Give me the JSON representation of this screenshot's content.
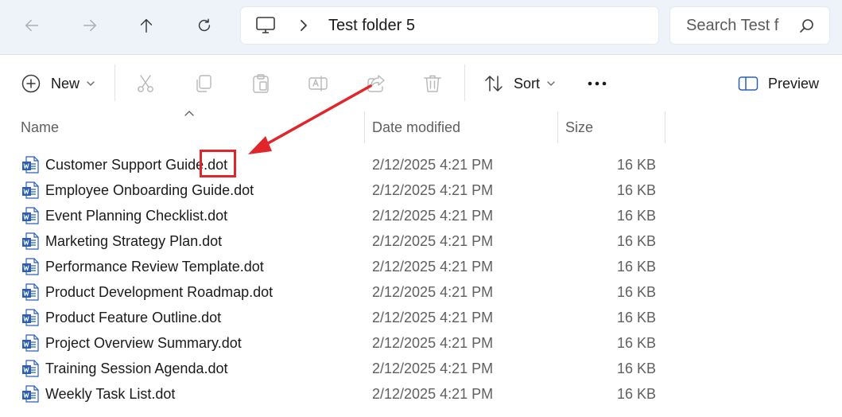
{
  "address": {
    "crumb": "Test folder 5"
  },
  "search": {
    "placeholder": "Search Test f"
  },
  "toolbar": {
    "new_label": "New",
    "sort_label": "Sort",
    "preview_label": "Preview"
  },
  "columns": {
    "name": "Name",
    "date": "Date modified",
    "size": "Size"
  },
  "files": [
    {
      "name": "Customer Support Guide.dot",
      "date": "2/12/2025 4:21 PM",
      "size": "16 KB"
    },
    {
      "name": "Employee Onboarding Guide.dot",
      "date": "2/12/2025 4:21 PM",
      "size": "16 KB"
    },
    {
      "name": "Event Planning Checklist.dot",
      "date": "2/12/2025 4:21 PM",
      "size": "16 KB"
    },
    {
      "name": "Marketing Strategy Plan.dot",
      "date": "2/12/2025 4:21 PM",
      "size": "16 KB"
    },
    {
      "name": "Performance Review Template.dot",
      "date": "2/12/2025 4:21 PM",
      "size": "16 KB"
    },
    {
      "name": "Product Development Roadmap.dot",
      "date": "2/12/2025 4:21 PM",
      "size": "16 KB"
    },
    {
      "name": "Product Feature Outline.dot",
      "date": "2/12/2025 4:21 PM",
      "size": "16 KB"
    },
    {
      "name": "Project Overview Summary.dot",
      "date": "2/12/2025 4:21 PM",
      "size": "16 KB"
    },
    {
      "name": "Training Session Agenda.dot",
      "date": "2/12/2025 4:21 PM",
      "size": "16 KB"
    },
    {
      "name": "Weekly Task List.dot",
      "date": "2/12/2025 4:21 PM",
      "size": "16 KB"
    }
  ],
  "icons": {
    "back": "arrow-left-icon",
    "forward": "arrow-right-icon",
    "up": "arrow-up-icon",
    "refresh": "refresh-icon",
    "this_pc": "monitor-icon",
    "search": "search-icon",
    "new": "plus-circle-icon",
    "cut": "scissors-icon",
    "copy": "copy-icon",
    "paste": "clipboard-icon",
    "rename": "rename-icon",
    "share": "share-icon",
    "delete": "trash-icon",
    "sort": "sort-icon",
    "more": "ellipsis-icon",
    "preview": "preview-pane-icon",
    "file": "word-document-icon"
  },
  "colors": {
    "nav_background": "#eef2f9",
    "accent_word": "#2b5eb3",
    "annotation": "#e0262b",
    "disabled_icon": "#b8b8b8"
  }
}
